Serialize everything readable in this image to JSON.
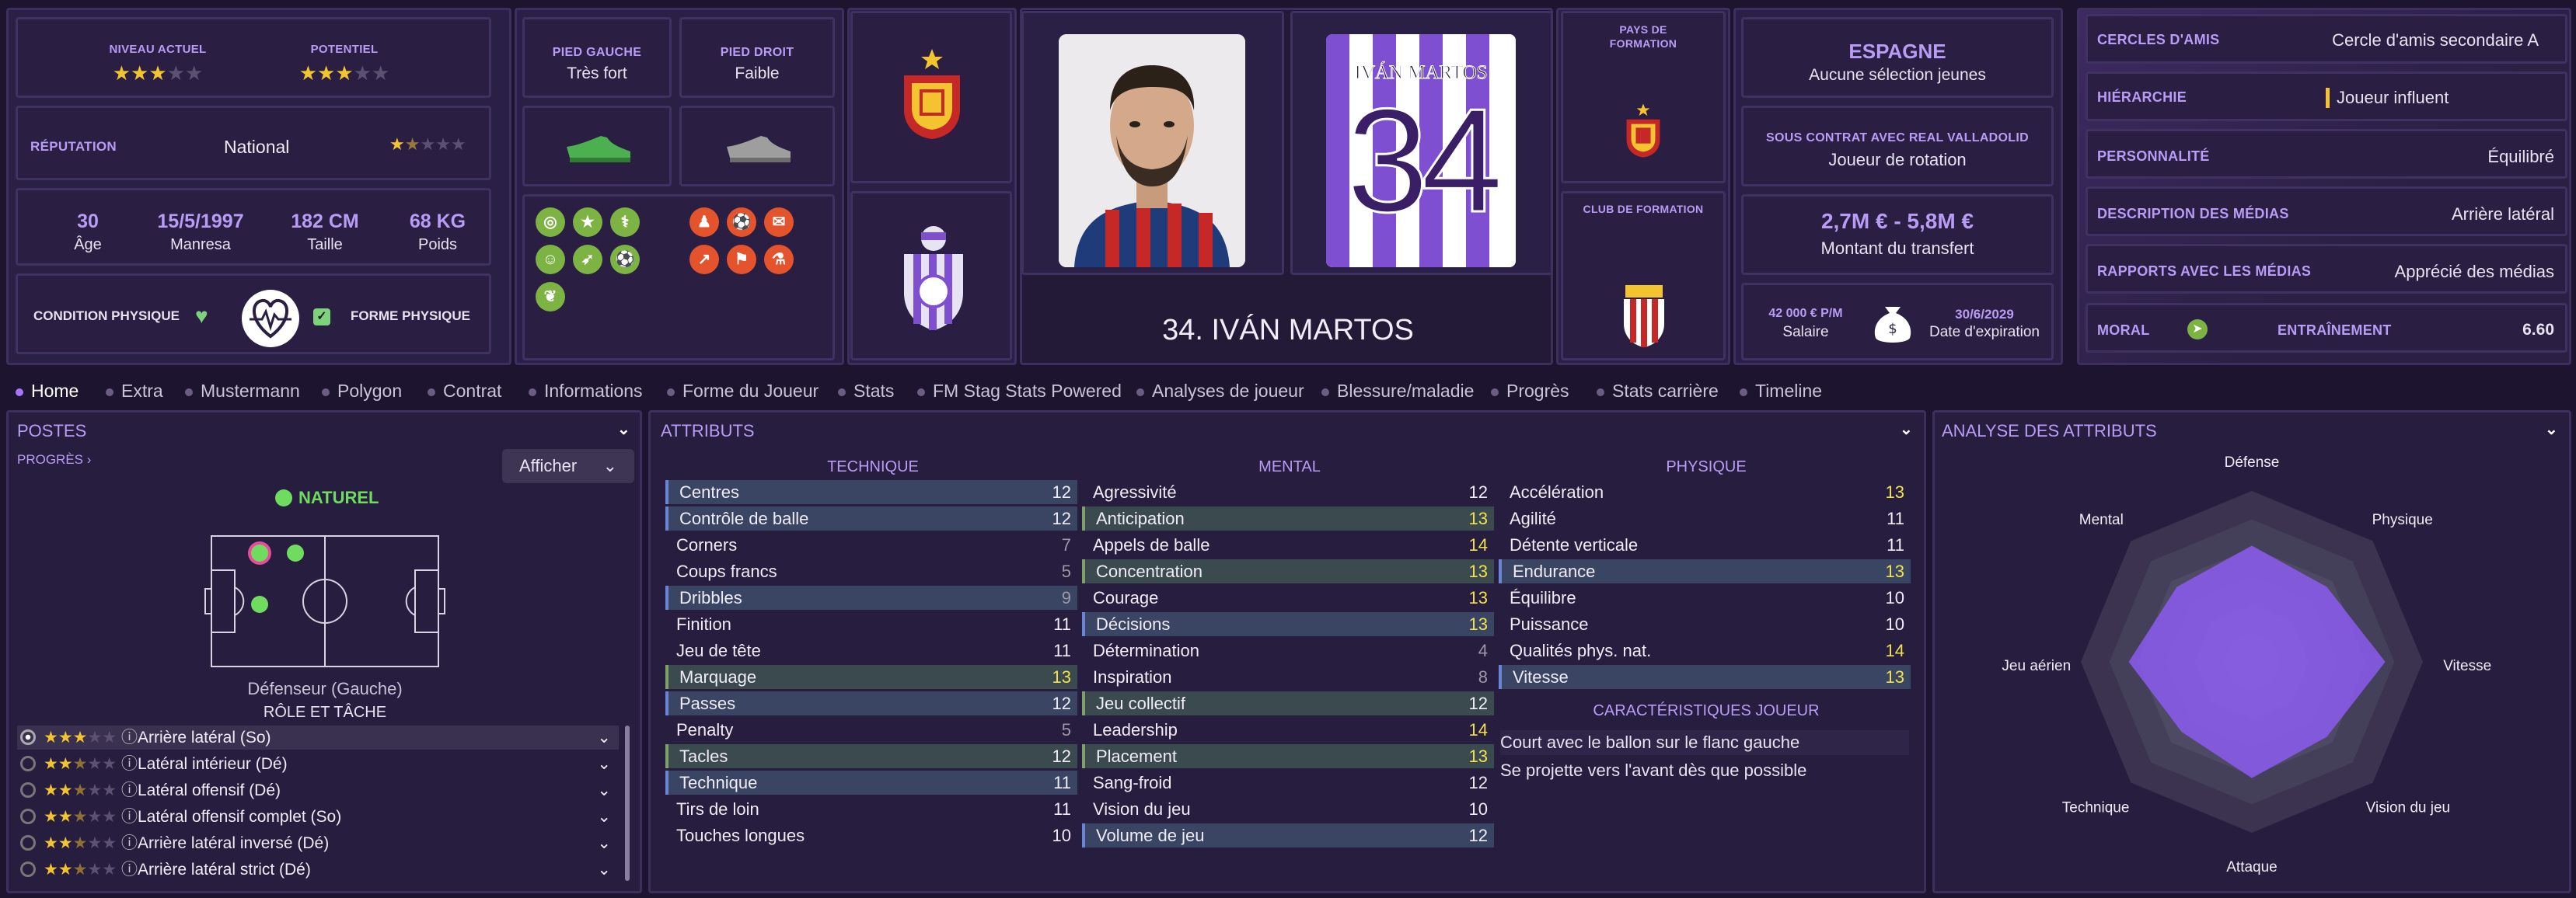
{
  "ratings": {
    "current_label": "NIVEAU ACTUEL",
    "potential_label": "POTENTIEL",
    "current_stars": 3,
    "potential_stars": 3
  },
  "reputation": {
    "label": "RÉPUTATION",
    "value": "National",
    "stars": 1.5
  },
  "bio": {
    "age": "30",
    "age_label": "Âge",
    "dob": "15/5/1997",
    "birthplace": "Manresa",
    "height": "182 CM",
    "height_label": "Taille",
    "weight": "68 KG",
    "weight_label": "Poids"
  },
  "condition": {
    "label": "CONDITION PHYSIQUE",
    "form_label": "FORME PHYSIQUE"
  },
  "feet": {
    "left_label": "PIED GAUCHE",
    "left_value": "Très fort",
    "right_label": "PIED DROIT",
    "right_value": "Faible"
  },
  "player": {
    "name_banner": "34. IVÁN MARTOS",
    "shirt_name": "IVÁN MARTOS",
    "shirt_number": "34"
  },
  "training_country": {
    "label": "PAYS DE FORMATION"
  },
  "training_club": {
    "label": "CLUB DE FORMATION"
  },
  "nation": {
    "name": "ESPAGNE",
    "caps": "Aucune sélection jeunes"
  },
  "contract": {
    "label": "SOUS CONTRAT AVEC REAL VALLADOLID",
    "status": "Joueur de rotation",
    "value": "2,7M € - 5,8M €",
    "value_label": "Montant du transfert",
    "wage": "42 000 € P/M",
    "wage_label": "Salaire",
    "expiry": "30/6/2029",
    "expiry_label": "Date d'expiration"
  },
  "info": [
    {
      "label": "CERCLES D'AMIS",
      "value": "Cercle d'amis secondaire A"
    },
    {
      "label": "HIÉRARCHIE",
      "value": "Joueur influent"
    },
    {
      "label": "PERSONNALITÉ",
      "value": "Équilibré"
    },
    {
      "label": "DESCRIPTION DES MÉDIAS",
      "value": "Arrière latéral"
    },
    {
      "label": "RAPPORTS AVEC LES MÉDIAS",
      "value": "Apprécié des médias"
    }
  ],
  "morale": {
    "label": "MORAL",
    "training_label": "ENTRAÎNEMENT",
    "training_value": "6.60"
  },
  "tabs": [
    "Home",
    "Extra",
    "Mustermann",
    "Polygon",
    "Contrat",
    "Informations",
    "Forme du Joueur",
    "Stats",
    "FM Stag Stats Powered",
    "Analyses de joueur",
    "Blessure/maladie",
    "Progrès",
    "Stats carrière",
    "Timeline"
  ],
  "positions": {
    "title": "POSTES",
    "progress": "PROGRÈS",
    "show_btn": "Afficher",
    "natural": "NATUREL",
    "position_name": "Défenseur (Gauche)",
    "role_title": "RÔLE ET TÂCHE",
    "roles": [
      {
        "name": "Arrière latéral (So)",
        "stars": 3
      },
      {
        "name": "Latéral intérieur (Dé)",
        "stars": 2.5
      },
      {
        "name": "Latéral offensif (Dé)",
        "stars": 2.5
      },
      {
        "name": "Latéral offensif complet (So)",
        "stars": 2.5
      },
      {
        "name": "Arrière latéral inversé (Dé)",
        "stars": 2.5
      },
      {
        "name": "Arrière latéral strict (Dé)",
        "stars": 2.5
      }
    ]
  },
  "attributes": {
    "title": "ATTRIBUTS",
    "tech_title": "TECHNIQUE",
    "mental_title": "MENTAL",
    "phys_title": "PHYSIQUE",
    "technique": [
      [
        "Centres",
        "12"
      ],
      [
        "Contrôle de balle",
        "12"
      ],
      [
        "Corners",
        "7"
      ],
      [
        "Coups francs",
        "5"
      ],
      [
        "Dribbles",
        "9"
      ],
      [
        "Finition",
        "11"
      ],
      [
        "Jeu de tête",
        "11"
      ],
      [
        "Marquage",
        "13"
      ],
      [
        "Passes",
        "12"
      ],
      [
        "Penalty",
        "5"
      ],
      [
        "Tacles",
        "12"
      ],
      [
        "Technique",
        "11"
      ],
      [
        "Tirs de loin",
        "11"
      ],
      [
        "Touches longues",
        "10"
      ]
    ],
    "mental": [
      [
        "Agressivité",
        "12"
      ],
      [
        "Anticipation",
        "13"
      ],
      [
        "Appels de balle",
        "14"
      ],
      [
        "Concentration",
        "13"
      ],
      [
        "Courage",
        "13"
      ],
      [
        "Décisions",
        "13"
      ],
      [
        "Détermination",
        "4"
      ],
      [
        "Inspiration",
        "8"
      ],
      [
        "Jeu collectif",
        "12"
      ],
      [
        "Leadership",
        "14"
      ],
      [
        "Placement",
        "13"
      ],
      [
        "Sang-froid",
        "12"
      ],
      [
        "Vision du jeu",
        "10"
      ],
      [
        "Volume de jeu",
        "12"
      ]
    ],
    "physique": [
      [
        "Accélération",
        "13"
      ],
      [
        "Agilité",
        "11"
      ],
      [
        "Détente verticale",
        "11"
      ],
      [
        "Endurance",
        "13"
      ],
      [
        "Équilibre",
        "10"
      ],
      [
        "Puissance",
        "10"
      ],
      [
        "Qualités phys. nat.",
        "14"
      ],
      [
        "Vitesse",
        "13"
      ]
    ],
    "traits_title": "CARACTÉRISTIQUES JOUEUR",
    "traits": [
      "Court avec le ballon sur le flanc gauche",
      "Se projette vers l'avant dès que possible"
    ]
  },
  "analysis": {
    "title": "ANALYSE DES ATTRIBUTS",
    "axes": [
      "Défense",
      "Physique",
      "Vitesse",
      "Vision du jeu",
      "Attaque",
      "Technique",
      "Jeu aérien",
      "Mental"
    ],
    "values": [
      0.68,
      0.62,
      0.78,
      0.62,
      0.68,
      0.58,
      0.72,
      0.62
    ]
  },
  "colors": {
    "accent": "#a875ff",
    "panel": "#2b2044",
    "gold": "#f4c430"
  }
}
